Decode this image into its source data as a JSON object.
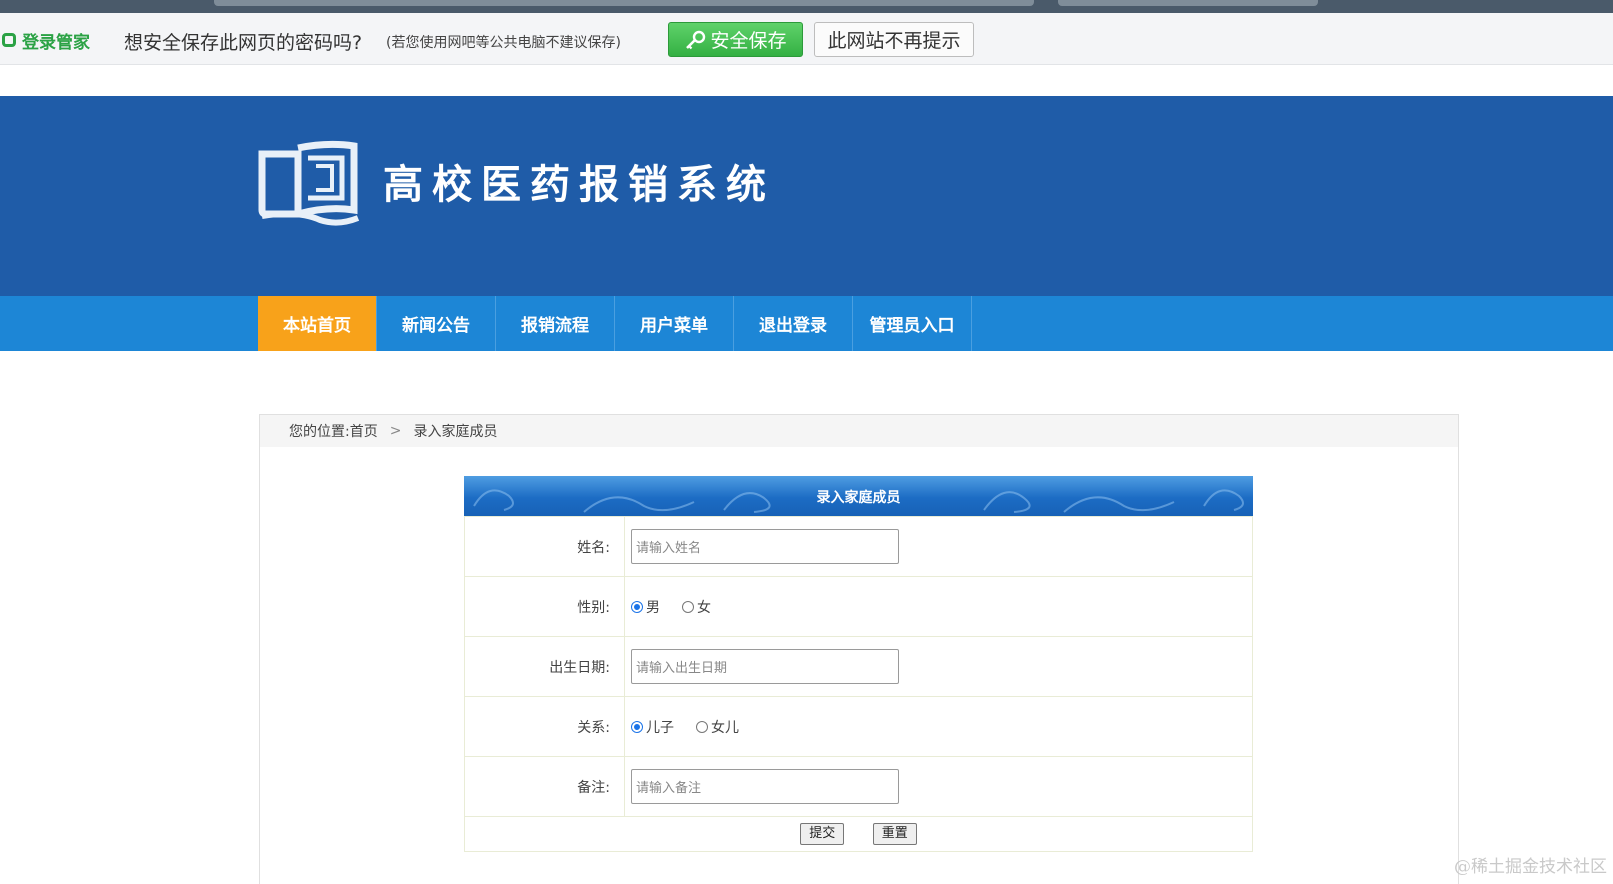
{
  "password_bar": {
    "brand": "登录管家",
    "question": "想安全保存此网页的密码吗?",
    "note": "(若您使用网吧等公共电脑不建议保存)",
    "save_label": "安全保存",
    "never_label": "此网站不再提示"
  },
  "header": {
    "title": "高校医药报销系统"
  },
  "nav": {
    "items": [
      {
        "label": "本站首页"
      },
      {
        "label": "新闻公告"
      },
      {
        "label": "报销流程"
      },
      {
        "label": "用户菜单"
      },
      {
        "label": "退出登录"
      },
      {
        "label": "管理员入口"
      }
    ]
  },
  "breadcrumb": {
    "prefix": "您的位置:",
    "home": "首页",
    "separator": ">",
    "current": "录入家庭成员"
  },
  "form": {
    "title": "录入家庭成员",
    "name": {
      "label": "姓名:",
      "placeholder": "请输入姓名"
    },
    "gender": {
      "label": "性别:",
      "options": [
        "男",
        "女"
      ],
      "selected": "男"
    },
    "birth": {
      "label": "出生日期:",
      "placeholder": "请输入出生日期"
    },
    "relation": {
      "label": "关系:",
      "options": [
        "儿子",
        "女儿"
      ],
      "selected": "儿子"
    },
    "remark": {
      "label": "备注:",
      "placeholder": "请输入备注"
    },
    "submit_label": "提交",
    "reset_label": "重置"
  },
  "watermark": "@稀土掘金技术社区",
  "colors": {
    "header_bg": "#1f5ca8",
    "nav_bg": "#1d86d6",
    "nav_active": "#f8a21a",
    "save_green": "#34b043"
  }
}
